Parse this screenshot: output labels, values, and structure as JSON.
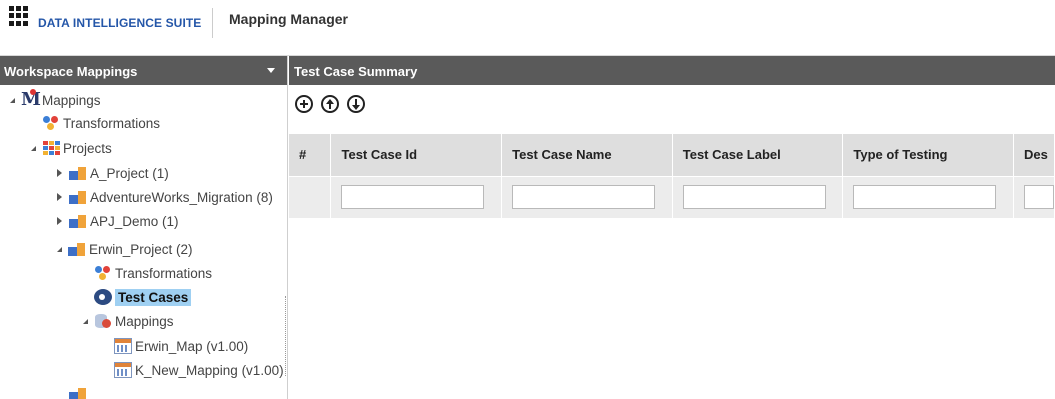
{
  "header": {
    "brand": "DATA INTELLIGENCE SUITE",
    "app_title": "Mapping Manager"
  },
  "left_panel": {
    "title": "Workspace Mappings",
    "tree": {
      "root": "Mappings",
      "transformations": "Transformations",
      "projects": "Projects",
      "project_items": [
        "A_Project (1)",
        "AdventureWorks_Migration (8)",
        "APJ_Demo (1)",
        "Erwin_Project (2)"
      ],
      "erwin_children": {
        "transformations": "Transformations",
        "test_cases": "Test Cases",
        "mappings": "Mappings",
        "maps": [
          "Erwin_Map (v1.00)",
          "K_New_Mapping (v1.00)"
        ]
      }
    }
  },
  "right_panel": {
    "title": "Test Case Summary",
    "actions": [
      "add-icon",
      "move-up-icon",
      "move-down-icon"
    ],
    "columns": [
      "#",
      "Test Case Id",
      "Test Case Name",
      "Test Case Label",
      "Type of Testing",
      "Des"
    ]
  }
}
